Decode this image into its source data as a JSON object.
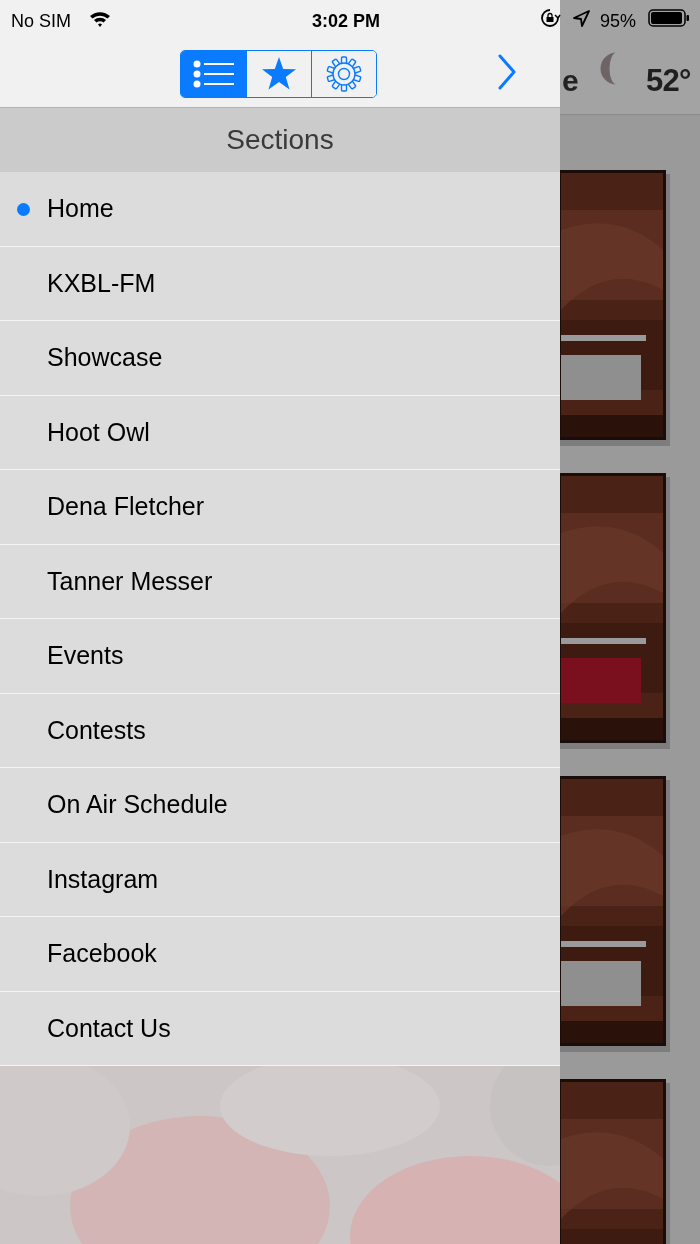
{
  "status_bar": {
    "carrier": "No SIM",
    "time": "3:02 PM",
    "battery": "95%"
  },
  "segments": [
    {
      "kind": "list",
      "selected": true
    },
    {
      "kind": "star",
      "selected": false
    },
    {
      "kind": "gear",
      "selected": false
    }
  ],
  "background_header": {
    "title_fragment": "e",
    "temperature": "52°"
  },
  "sections": {
    "title": "Sections",
    "items": [
      {
        "label": "Home",
        "selected": true
      },
      {
        "label": "KXBL-FM",
        "selected": false
      },
      {
        "label": "Showcase",
        "selected": false
      },
      {
        "label": "Hoot Owl",
        "selected": false
      },
      {
        "label": "Dena Fletcher",
        "selected": false
      },
      {
        "label": "Tanner Messer",
        "selected": false
      },
      {
        "label": "Events",
        "selected": false
      },
      {
        "label": "Contests",
        "selected": false
      },
      {
        "label": "On Air Schedule",
        "selected": false
      },
      {
        "label": "Instagram",
        "selected": false
      },
      {
        "label": "Facebook",
        "selected": false
      },
      {
        "label": "Contact Us",
        "selected": false
      }
    ]
  }
}
